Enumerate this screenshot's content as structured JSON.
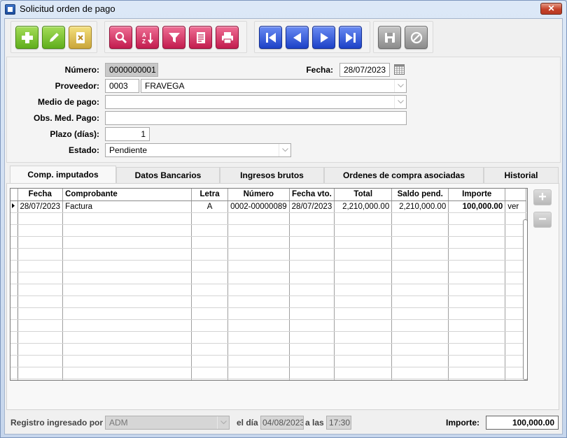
{
  "window": {
    "title": "Solicitud orden de pago",
    "close_glyph": "✕"
  },
  "toolbar": {
    "icons": [
      "plus-icon",
      "pencil-icon",
      "delete-icon",
      "search-icon",
      "sort-az-icon",
      "filter-icon",
      "report-icon",
      "print-icon",
      "first-record-icon",
      "previous-record-icon",
      "next-record-icon",
      "last-record-icon",
      "save-icon",
      "cancel-icon"
    ],
    "sort_text": "AZ"
  },
  "form": {
    "numero_label": "Número:",
    "numero_value": "0000000001",
    "fecha_label": "Fecha:",
    "fecha_value": "28/07/2023",
    "proveedor_label": "Proveedor:",
    "proveedor_code": "0003",
    "proveedor_name": "FRAVEGA",
    "medio_pago_label": "Medio de pago:",
    "medio_pago_value": "",
    "obs_label": "Obs. Med. Pago:",
    "obs_value": "",
    "plazo_label": "Plazo (días):",
    "plazo_value": "1",
    "estado_label": "Estado:",
    "estado_value": "Pendiente"
  },
  "tabs": [
    {
      "label": "Comp. imputados",
      "active": true
    },
    {
      "label": "Datos Bancarios",
      "active": false
    },
    {
      "label": "Ingresos brutos",
      "active": false
    },
    {
      "label": "Ordenes de compra asociadas",
      "active": false
    },
    {
      "label": "Historial",
      "active": false
    }
  ],
  "grid": {
    "columns": [
      "Fecha",
      "Comprobante",
      "Letra",
      "Número",
      "Fecha vto.",
      "Total",
      "Saldo pend.",
      "Importe",
      ""
    ],
    "rows": [
      [
        "28/07/2023",
        "Factura",
        "A",
        "0002-00000089",
        "28/07/2023",
        "2,210,000.00",
        "2,210,000.00",
        "100,000.00",
        "ver"
      ]
    ],
    "empty_rows": 15
  },
  "side_buttons": {
    "add_glyph": "+",
    "remove_glyph": "−"
  },
  "status": {
    "registered_by_label": "Registro ingresado por",
    "registered_by_value": "ADM",
    "day_label": "el día",
    "day_value": "04/08/2023",
    "at_label": "a las",
    "at_value": "17:30",
    "importe_label": "Importe:",
    "importe_value": "100,000.00"
  }
}
